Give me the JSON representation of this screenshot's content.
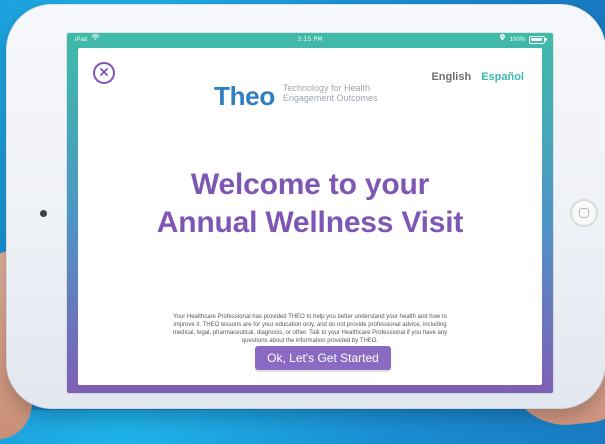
{
  "status_bar": {
    "device": "iPad",
    "time": "3:15 PM",
    "battery": "100%"
  },
  "header": {
    "logo_word": "Theo",
    "tagline_line1": "Technology for Health",
    "tagline_line2": "Engagement Outcomes",
    "language_english": "English",
    "language_espanol": "Español"
  },
  "main": {
    "title_line1": "Welcome to your",
    "title_line2": "Annual Wellness Visit",
    "disclaimer_line1": "Your Healthcare Professional has provided THEO to help you better understand your health and how to",
    "disclaimer_line2": "improve it.  THEO lessons are for your education only, and do not provide professional advice, including",
    "disclaimer_line3": "medical, legal, pharmaceutical, diagnosis, or other.  Talk to your Healthcare Professional if you have any",
    "disclaimer_line4": "questions about the information provided by THEO.",
    "start_button_label": "Ok, Let's Get Started"
  },
  "colors": {
    "accent_purple": "#7e56b4",
    "button_purple": "#8b6ac3",
    "teal": "#3bb9b1",
    "logo_blue": "#2f7fc3"
  }
}
